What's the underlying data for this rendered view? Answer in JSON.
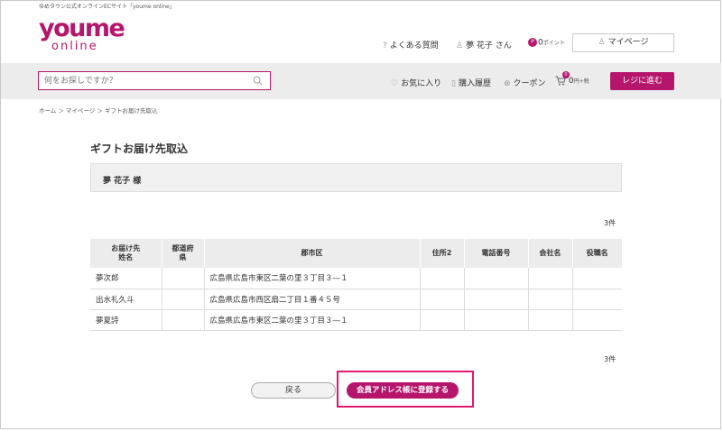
{
  "header": {
    "tagline": "ゆめタウン公式オンラインECサイト「youme online」",
    "logo": {
      "top": "youme",
      "bottom": "online"
    },
    "faq_label": "よくある質問",
    "user_name": "夢 花子 さん",
    "points": {
      "badge": "P",
      "value": "0",
      "unit": "ポイント"
    },
    "mypage_label": "マイページ"
  },
  "search": {
    "placeholder": "何をお探しですか？"
  },
  "nav": {
    "favorites": "お気に入り",
    "history": "購入履歴",
    "coupon": "クーポン",
    "cart_badge": "0",
    "cart_amount": "0",
    "cart_unit": "円+税",
    "checkout_label": "レジに進む"
  },
  "breadcrumb": "ホーム ＞ マイページ ＞ ギフトお届け先取込",
  "page": {
    "title": "ギフトお届け先取込",
    "customer": "夢 花子 様",
    "count_top": "3件",
    "count_bottom": "3件"
  },
  "table": {
    "headers": [
      "お届け先姓名",
      "都道府県",
      "郡市区",
      "住所2",
      "電話番号",
      "会社名",
      "役職名"
    ],
    "header_lines": [
      [
        "お届け先",
        "姓名"
      ],
      [
        "都道府",
        "県"
      ],
      [
        "郡市区"
      ],
      [
        "住所2"
      ],
      [
        "電話番号"
      ],
      [
        "会社名"
      ],
      [
        "役職名"
      ]
    ],
    "rows": [
      [
        "夢次郎",
        "",
        "広島県広島市東区二葉の里３丁目３―１",
        "",
        "",
        "",
        ""
      ],
      [
        "出水礼久斗",
        "",
        "広島県広島市西区扇二丁目１番４５号",
        "",
        "",
        "",
        ""
      ],
      [
        "夢夏詩",
        "",
        "広島県広島市東区二葉の里３丁目３―１",
        "",
        "",
        "",
        ""
      ]
    ]
  },
  "actions": {
    "back_label": "戻る",
    "register_label": "会員アドレス帳に登録する"
  },
  "colors": {
    "brand": "#b5166b",
    "highlight": "#e0196e"
  }
}
